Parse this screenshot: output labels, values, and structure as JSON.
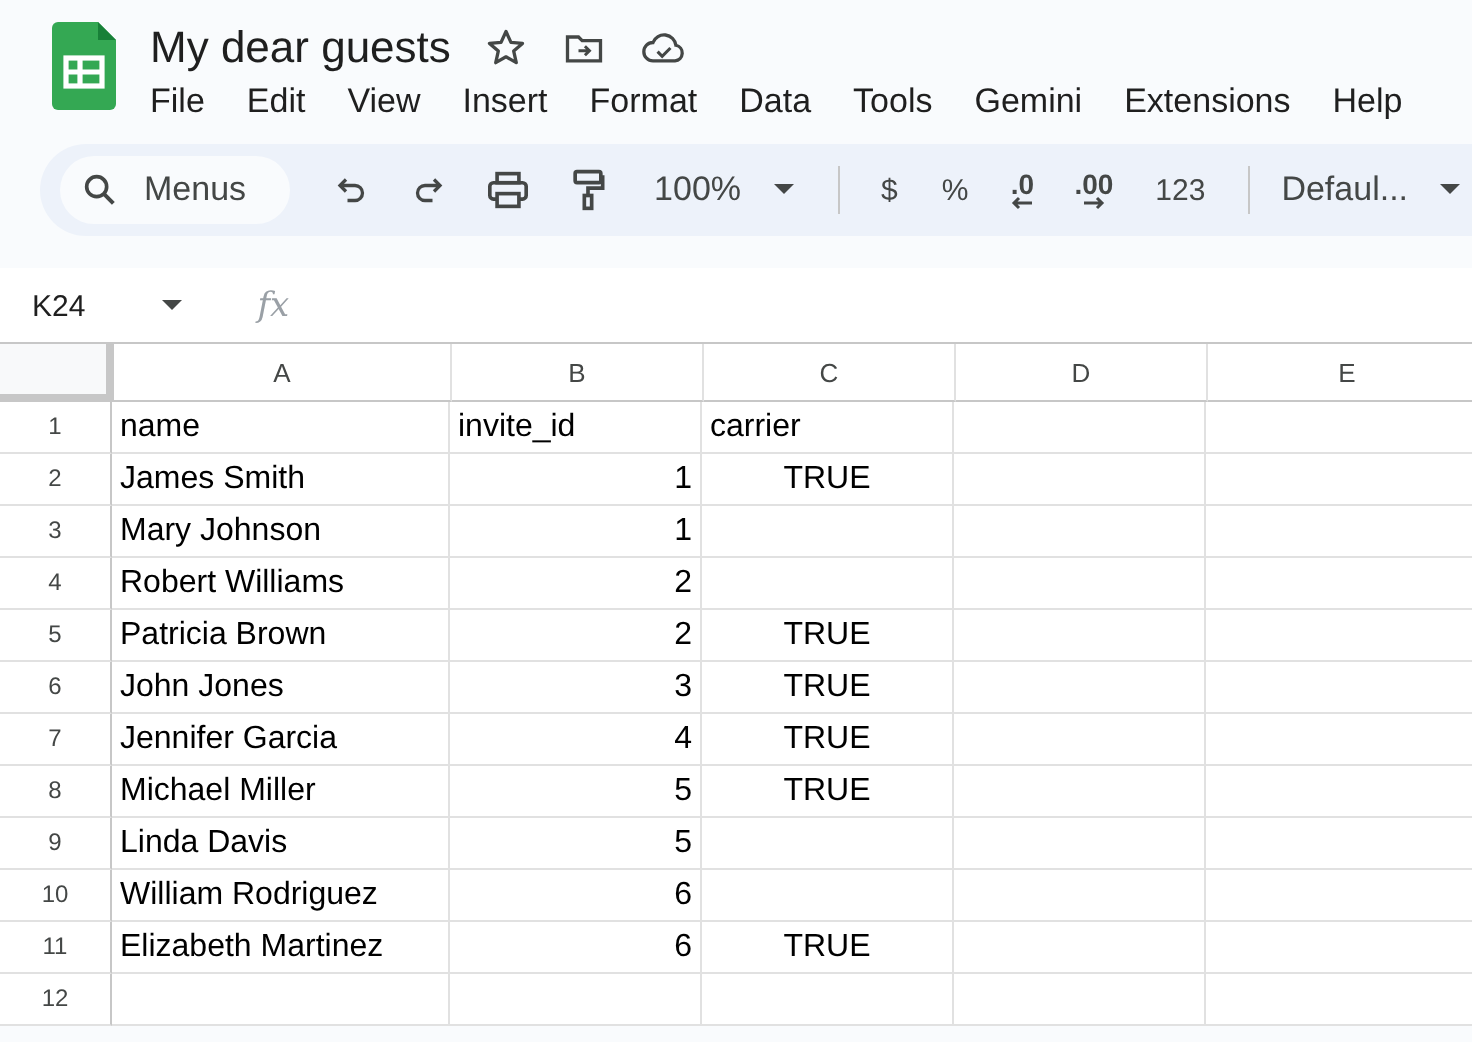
{
  "document": {
    "title": "My dear guests"
  },
  "menu": [
    "File",
    "Edit",
    "View",
    "Insert",
    "Format",
    "Data",
    "Tools",
    "Gemini",
    "Extensions",
    "Help"
  ],
  "toolbar": [
    {
      "kind": "search",
      "label": "Menus"
    },
    {
      "kind": "undo"
    },
    {
      "kind": "redo"
    },
    {
      "kind": "print"
    },
    {
      "kind": "paint"
    },
    {
      "kind": "zoom",
      "label": "100%"
    },
    {
      "kind": "divider"
    },
    {
      "kind": "text",
      "label": "$"
    },
    {
      "kind": "text",
      "label": "%"
    },
    {
      "kind": "decrease",
      "label": ".0"
    },
    {
      "kind": "increase",
      "label": ".00"
    },
    {
      "kind": "text",
      "label": "123"
    },
    {
      "kind": "divider"
    },
    {
      "kind": "font",
      "label": "Defaul..."
    }
  ],
  "formula_bar": {
    "cell_ref": "K24",
    "function_label": "fx"
  },
  "columns": [
    "A",
    "B",
    "C",
    "D",
    "E"
  ],
  "rows": [
    {
      "number": "1",
      "column_a": {
        "value": "name",
        "kind": "text"
      },
      "column_b": {
        "value": "invite_id",
        "kind": "text"
      },
      "column_c": {
        "value": "carrier",
        "kind": "text"
      }
    },
    {
      "number": "2",
      "column_a": {
        "value": "James Smith",
        "kind": "text"
      },
      "column_b": {
        "value": "1",
        "kind": "number"
      },
      "column_c": {
        "value": "TRUE",
        "kind": "boolean"
      }
    },
    {
      "number": "3",
      "column_a": {
        "value": "Mary Johnson",
        "kind": "text"
      },
      "column_b": {
        "value": "1",
        "kind": "number"
      }
    },
    {
      "number": "4",
      "column_a": {
        "value": "Robert Williams",
        "kind": "text"
      },
      "column_b": {
        "value": "2",
        "kind": "number"
      }
    },
    {
      "number": "5",
      "column_a": {
        "value": "Patricia Brown",
        "kind": "text"
      },
      "column_b": {
        "value": "2",
        "kind": "number"
      },
      "column_c": {
        "value": "TRUE",
        "kind": "boolean"
      }
    },
    {
      "number": "6",
      "column_a": {
        "value": "John Jones",
        "kind": "text"
      },
      "column_b": {
        "value": "3",
        "kind": "number"
      },
      "column_c": {
        "value": "TRUE",
        "kind": "boolean"
      }
    },
    {
      "number": "7",
      "column_a": {
        "value": "Jennifer Garcia",
        "kind": "text"
      },
      "column_b": {
        "value": "4",
        "kind": "number"
      },
      "column_c": {
        "value": "TRUE",
        "kind": "boolean"
      }
    },
    {
      "number": "8",
      "column_a": {
        "value": "Michael Miller",
        "kind": "text"
      },
      "column_b": {
        "value": "5",
        "kind": "number"
      },
      "column_c": {
        "value": "TRUE",
        "kind": "boolean"
      }
    },
    {
      "number": "9",
      "column_a": {
        "value": "Linda Davis",
        "kind": "text"
      },
      "column_b": {
        "value": "5",
        "kind": "number"
      }
    },
    {
      "number": "10",
      "column_a": {
        "value": "William Rodriguez",
        "kind": "text"
      },
      "column_b": {
        "value": "6",
        "kind": "number"
      }
    },
    {
      "number": "11",
      "column_a": {
        "value": "Elizabeth Martinez",
        "kind": "text"
      },
      "column_b": {
        "value": "6",
        "kind": "number"
      },
      "column_c": {
        "value": "TRUE",
        "kind": "boolean"
      }
    },
    {
      "number": "12"
    }
  ]
}
